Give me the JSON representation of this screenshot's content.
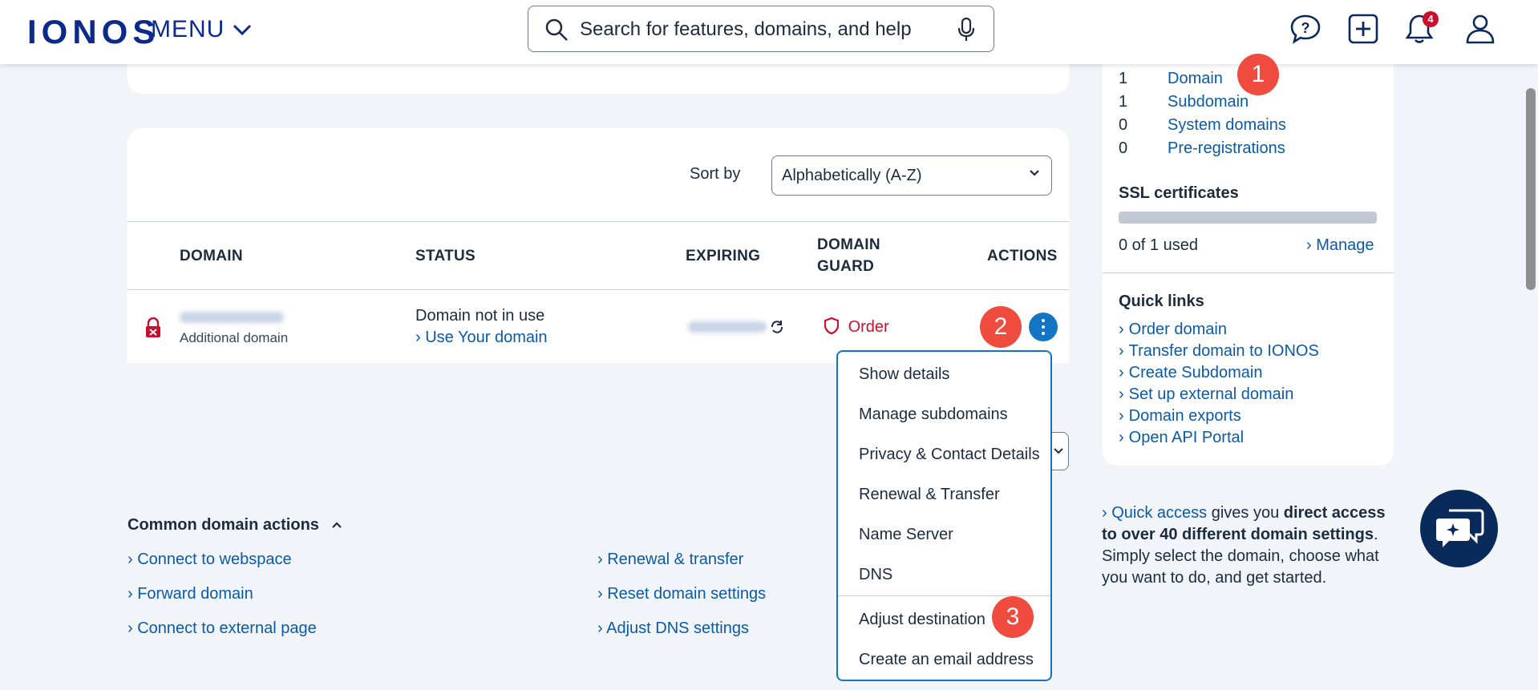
{
  "header": {
    "logo": "IONOS",
    "menu_label": "MENU",
    "search_placeholder": "Search for features, domains, and help",
    "notifications_count": "4",
    "icons": [
      "help-chat-icon",
      "add-icon",
      "bell-icon",
      "user-icon",
      "search-icon",
      "microphone-icon"
    ]
  },
  "summary": {
    "rows": [
      {
        "count": "1",
        "label": "Domain"
      },
      {
        "count": "1",
        "label": "Subdomain"
      },
      {
        "count": "0",
        "label": "System domains"
      },
      {
        "count": "0",
        "label": "Pre-registrations"
      }
    ],
    "ssl_title": "SSL certificates",
    "ssl_usage": "0 of 1 used",
    "ssl_manage": "Manage"
  },
  "quick_links": {
    "title": "Quick links",
    "items": [
      "Order domain",
      "Transfer domain to IONOS",
      "Create Subdomain",
      "Set up external domain",
      "Domain exports",
      "Open API Portal"
    ]
  },
  "quick_access": {
    "link": "Quick access",
    "text1": " gives you ",
    "bold": "direct access to over 40 different domain settings",
    "text2": ". Simply select the domain, choose what you want to do, and get started."
  },
  "table": {
    "sort_label": "Sort by",
    "sort_value": "Alphabetically (A-Z)",
    "headers": {
      "domain": "DOMAIN",
      "status": "STATUS",
      "expiring": "EXPIRING",
      "guard_line1": "DOMAIN",
      "guard_line2": "GUARD",
      "actions": "ACTIONS"
    },
    "row": {
      "domain_type": "Additional domain",
      "status": "Domain not in use",
      "status_link": "Use Your domain",
      "guard": "Order"
    }
  },
  "actions_menu": {
    "items": [
      "Show details",
      "Manage subdomains",
      "Privacy & Contact Details",
      "Renewal & Transfer",
      "Name Server",
      "DNS",
      "Adjust destination",
      "Create an email address"
    ]
  },
  "steps": [
    "1",
    "2",
    "3"
  ],
  "common_actions": {
    "title": "Common domain actions",
    "left": [
      "Connect to webspace",
      "Forward domain",
      "Connect to external page"
    ],
    "right": [
      "Renewal & transfer",
      "Reset domain settings",
      "Adjust DNS settings"
    ]
  },
  "colors": {
    "brand": "#0b2a8c",
    "link": "#0b5aa6",
    "accent_blue": "#1474c4",
    "step_red": "#ef4b3f",
    "guard_red": "#c8102e"
  }
}
